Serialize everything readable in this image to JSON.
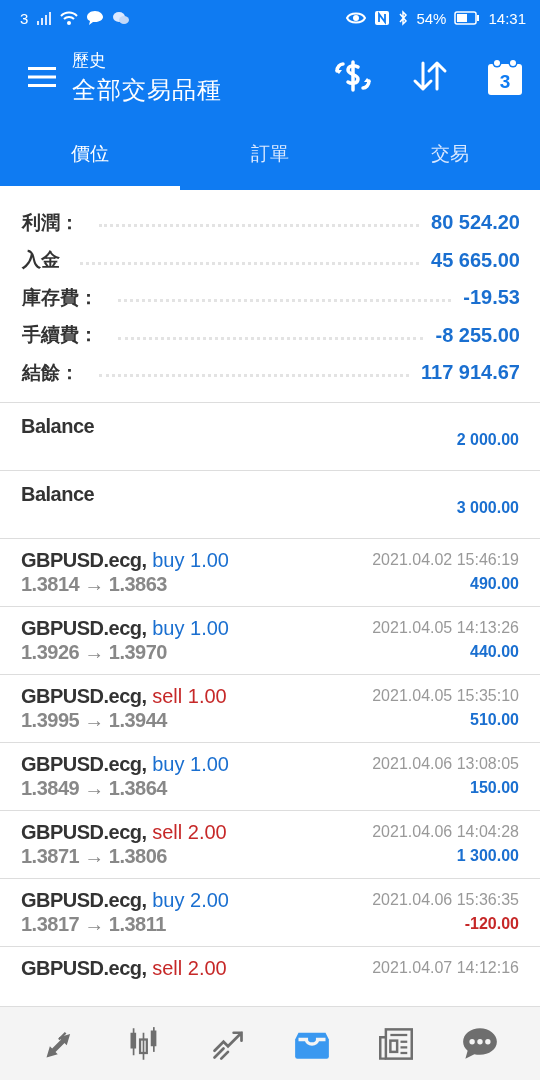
{
  "status_bar": {
    "carrier": "3",
    "battery": "54%",
    "time": "14:31"
  },
  "header": {
    "subtitle": "歷史",
    "title": "全部交易品種",
    "calendar_day": "3"
  },
  "tabs": [
    {
      "label": "價位",
      "selected": true
    },
    {
      "label": "訂單",
      "selected": false
    },
    {
      "label": "交易",
      "selected": false
    }
  ],
  "summary": [
    {
      "label": "利潤：",
      "value": "80 524.20"
    },
    {
      "label": "入金",
      "value": "45 665.00"
    },
    {
      "label": "庫存費：",
      "value": "-19.53"
    },
    {
      "label": "手續費：",
      "value": "-8 255.00"
    },
    {
      "label": "結餘：",
      "value": "117 914.67"
    }
  ],
  "deals": [
    {
      "kind": "balance",
      "title": "Balance",
      "profit": "2 000.00",
      "loss": false
    },
    {
      "kind": "balance",
      "title": "Balance",
      "profit": "3 000.00",
      "loss": false
    },
    {
      "kind": "buy",
      "symbol": "GBPUSD.ecg,",
      "volume": "buy 1.00",
      "prices": "1.3814 → 1.3863",
      "time": "2021.04.02 15:46:19",
      "profit": "490.00",
      "loss": false
    },
    {
      "kind": "buy",
      "symbol": "GBPUSD.ecg,",
      "volume": "buy 1.00",
      "prices": "1.3926 → 1.3970",
      "time": "2021.04.05 14:13:26",
      "profit": "440.00",
      "loss": false
    },
    {
      "kind": "sell",
      "symbol": "GBPUSD.ecg,",
      "volume": "sell 1.00",
      "prices": "1.3995 → 1.3944",
      "time": "2021.04.05 15:35:10",
      "profit": "510.00",
      "loss": false
    },
    {
      "kind": "buy",
      "symbol": "GBPUSD.ecg,",
      "volume": "buy 1.00",
      "prices": "1.3849 → 1.3864",
      "time": "2021.04.06 13:08:05",
      "profit": "150.00",
      "loss": false
    },
    {
      "kind": "sell",
      "symbol": "GBPUSD.ecg,",
      "volume": "sell 2.00",
      "prices": "1.3871 → 1.3806",
      "time": "2021.04.06 14:04:28",
      "profit": "1 300.00",
      "loss": false
    },
    {
      "kind": "buy",
      "symbol": "GBPUSD.ecg,",
      "volume": "buy 2.00",
      "prices": "1.3817 → 1.3811",
      "time": "2021.04.06 15:36:35",
      "profit": "-120.00",
      "loss": true
    },
    {
      "kind": "sell",
      "symbol": "GBPUSD.ecg,",
      "volume": "sell 2.00",
      "time": "2021.04.07 14:12:16"
    }
  ],
  "bottom_nav": [
    {
      "kind": "quotes",
      "selected": false
    },
    {
      "kind": "chart",
      "selected": false
    },
    {
      "kind": "trade",
      "selected": false
    },
    {
      "kind": "history",
      "selected": true
    },
    {
      "kind": "news",
      "selected": false
    },
    {
      "kind": "chat",
      "selected": false
    }
  ]
}
